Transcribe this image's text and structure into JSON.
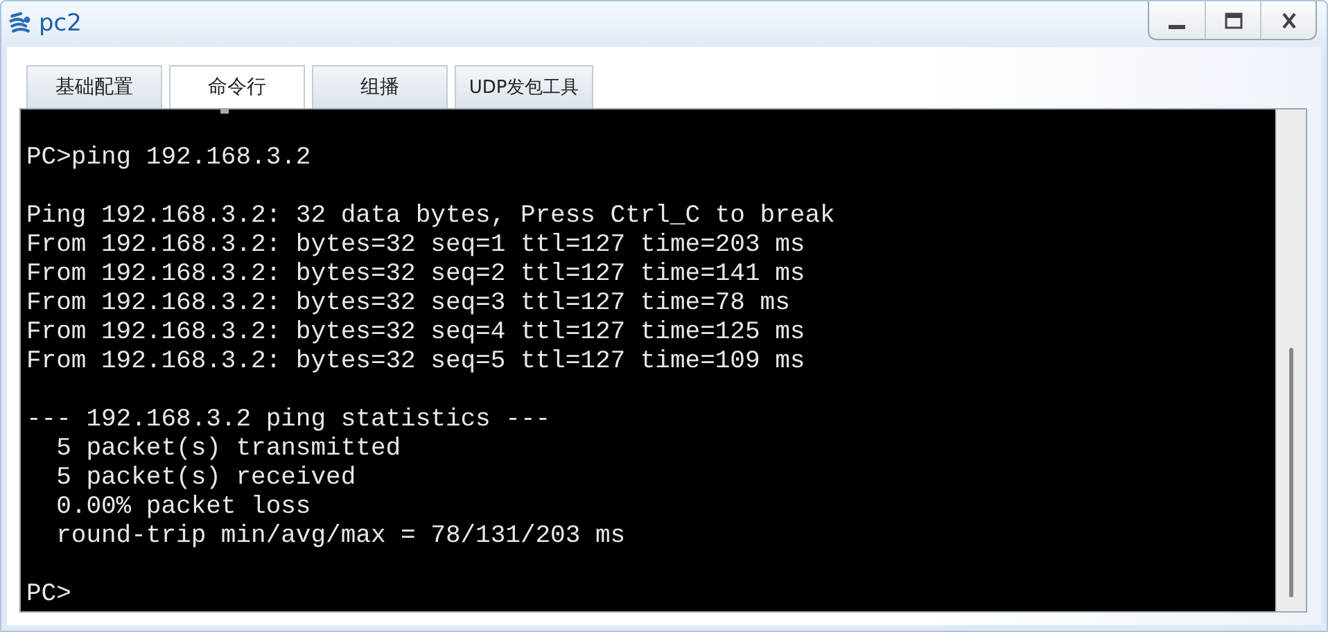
{
  "window": {
    "title": "pc2"
  },
  "tabs": [
    {
      "label": "基础配置",
      "selected": false
    },
    {
      "label": "命令行",
      "selected": true
    },
    {
      "label": "组播",
      "selected": false
    },
    {
      "label": "UDP发包工具",
      "selected": false
    }
  ],
  "terminal": {
    "blocks": [
      [
        "PC>ping 192.168.3.2"
      ],
      [
        "Ping 192.168.3.2: 32 data bytes, Press Ctrl_C to break",
        "From 192.168.3.2: bytes=32 seq=1 ttl=127 time=203 ms",
        "From 192.168.3.2: bytes=32 seq=2 ttl=127 time=141 ms",
        "From 192.168.3.2: bytes=32 seq=3 ttl=127 time=78 ms",
        "From 192.168.3.2: bytes=32 seq=4 ttl=127 time=125 ms",
        "From 192.168.3.2: bytes=32 seq=5 ttl=127 time=109 ms"
      ],
      [
        "--- 192.168.3.2 ping statistics ---",
        "  5 packet(s) transmitted",
        "  5 packet(s) received",
        "  0.00% packet loss",
        "  round-trip min/avg/max = 78/131/203 ms"
      ],
      [
        "PC>"
      ]
    ]
  }
}
